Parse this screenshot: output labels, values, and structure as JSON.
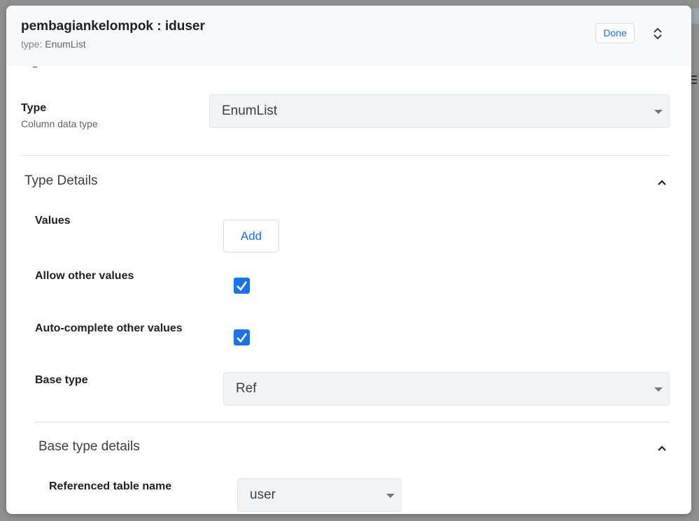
{
  "dialog": {
    "title": "pembagiankelompok : iduser",
    "subtitle_prefix": "type:",
    "subtitle_value": "EnumList",
    "done_label": "Done"
  },
  "type_field": {
    "label": "Type",
    "help": "Column data type",
    "value": "EnumList"
  },
  "type_details": {
    "title": "Type Details",
    "values_label": "Values",
    "add_label": "Add",
    "allow_other_label": "Allow other values",
    "allow_other_checked": true,
    "autocomplete_label": "Auto-complete other values",
    "autocomplete_checked": true,
    "base_type_label": "Base type",
    "base_type_value": "Ref"
  },
  "base_type_details": {
    "title": "Base type details",
    "referenced_table_label": "Referenced table name",
    "referenced_table_value": "user"
  },
  "colors": {
    "accent": "#1a73e8",
    "header_bg": "#f8f9fa",
    "select_bg": "#f1f3f4"
  },
  "icons": {
    "expand": "unfold-more-icon",
    "collapse": "chevron-up-icon",
    "dropdown": "caret-down-icon",
    "check": "check-icon"
  }
}
